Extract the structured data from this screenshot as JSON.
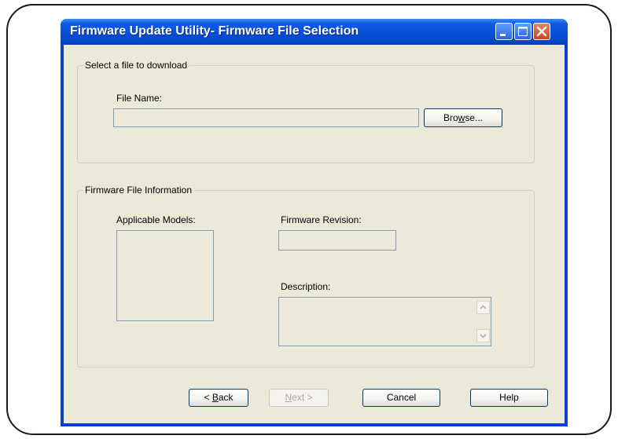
{
  "window": {
    "title": "Firmware Update Utility- Firmware File Selection"
  },
  "file_group": {
    "legend": "Select a file to download",
    "file_name_label": "File Name:",
    "file_name_value": "",
    "browse": {
      "pre": "Bro",
      "accel": "w",
      "post": "se..."
    }
  },
  "info_group": {
    "legend": "Firmware File Information",
    "models_label": "Applicable Models:",
    "revision_label": "Firmware Revision:",
    "description_label": "Description:"
  },
  "buttons": {
    "back": {
      "prefix": "< ",
      "accel": "B",
      "post": "ack"
    },
    "next": {
      "accel": "N",
      "post": "ext >"
    },
    "cancel": "Cancel",
    "help": "Help"
  },
  "icons": {
    "minimize": "minimize-icon",
    "maximize": "maximize-icon",
    "close": "close-icon",
    "scroll_up": "chevron-up-icon",
    "scroll_down": "chevron-down-icon"
  },
  "colors": {
    "titlebar": "#0a3fd4",
    "dialog_bg": "#ece9d8",
    "close_button": "#c8431f"
  }
}
